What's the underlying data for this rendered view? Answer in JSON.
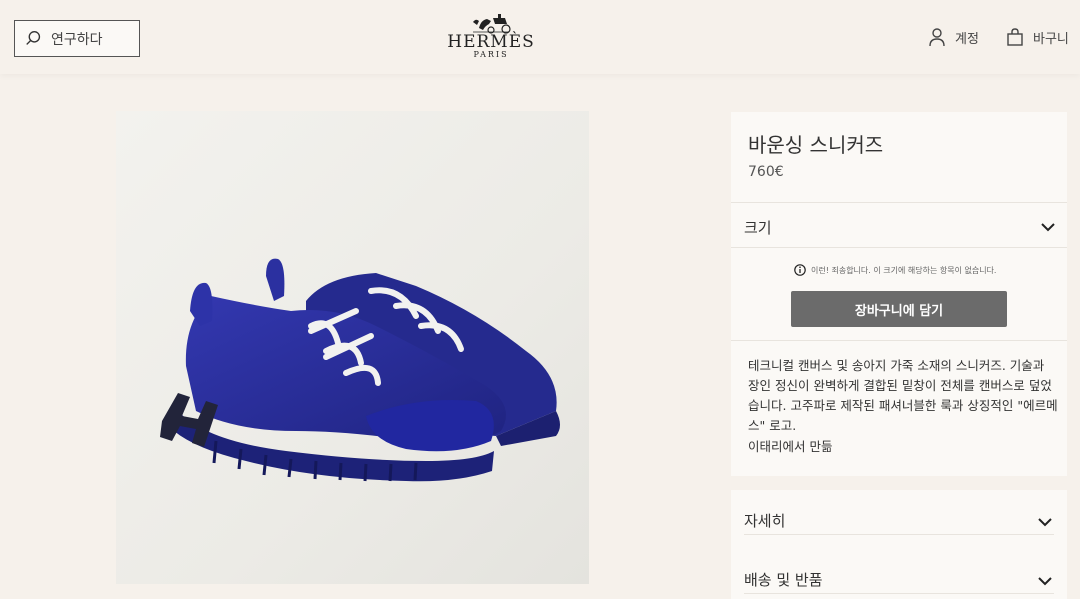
{
  "header": {
    "search_placeholder": "연구하다",
    "logo_word": "HERMÈS",
    "logo_sub": "PARIS",
    "account_label": "계정",
    "cart_label": "바구니"
  },
  "product": {
    "title": "바운싱 스니커즈",
    "price": "760€",
    "size_label": "크기",
    "notice": "이런! 죄송합니다. 이 크기에 해당하는 항목이 없습니다.",
    "add_to_cart": "장바구니에 담기",
    "description": "테크니컬 캔버스 및 송아지 가죽 소재의 스니커즈. 기술과 장인 정신이 완벽하게 결합된 밑창이 전체를 캔버스로 덮었습니다. 고주파로 제작된 패셔너블한 룩과 상징적인 \"에르메스\" 로고.",
    "origin": "이태리에서 만듦"
  },
  "accordions": [
    {
      "label": "자세히"
    },
    {
      "label": "배송 및 반품"
    }
  ],
  "colors": {
    "background": "#f6f1eb",
    "panel": "#fbf9f6",
    "button": "#6b6b6b",
    "shoe_blue": "#2a2fa0"
  }
}
